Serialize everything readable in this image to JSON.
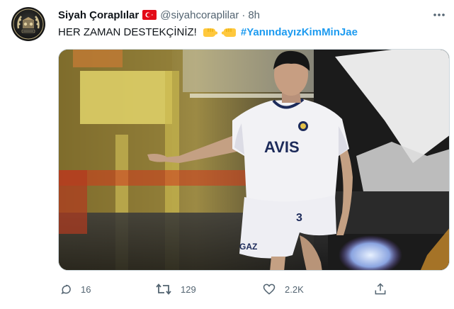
{
  "tweet": {
    "author_name": "Siyah Çoraplılar",
    "handle": "@siyahcoraplilar",
    "separator": "·",
    "time": "8h",
    "text": "HER ZAMAN DESTEKÇİNİZ!",
    "hashtag": "#YanındayızKimMinJae",
    "avatar_icon": "team-logo",
    "flag_icon": "turkey-flag-icon",
    "emojis": [
      "fist-left-emoji",
      "fist-right-emoji"
    ],
    "image": {
      "description": "football-player-photo",
      "shirt_text": "AVIS",
      "shirt_number": "3",
      "shorts_text": "GAZ"
    },
    "actions": {
      "reply_count": "16",
      "retweet_count": "129",
      "like_count": "2.2K"
    }
  },
  "colors": {
    "text": "#0f1419",
    "secondary": "#536471",
    "link": "#1d9bf0",
    "border": "#cfd9de"
  }
}
